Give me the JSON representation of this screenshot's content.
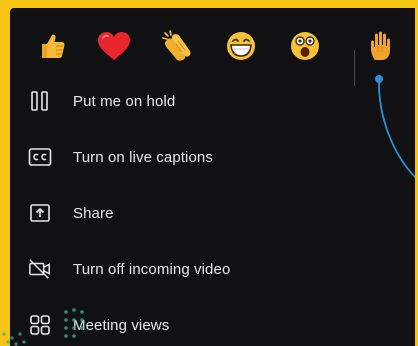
{
  "reactions": [
    {
      "icon": "thumbs-up-icon"
    },
    {
      "icon": "heart-icon"
    },
    {
      "icon": "clapping-hands-icon"
    },
    {
      "icon": "laughing-face-icon"
    },
    {
      "icon": "surprised-face-icon"
    },
    {
      "icon": "raised-hand-icon"
    }
  ],
  "menu": {
    "items": [
      {
        "label": "Put me on hold",
        "icon": "pause-icon"
      },
      {
        "label": "Turn on live captions",
        "icon": "closed-captions-icon"
      },
      {
        "label": "Share",
        "icon": "share-tray-icon"
      },
      {
        "label": "Turn off incoming video",
        "icon": "video-off-icon"
      },
      {
        "label": "Meeting views",
        "icon": "grid-view-icon"
      }
    ]
  },
  "colors": {
    "frame": "#f4c512",
    "panel": "#111114",
    "text": "#e8e8ec",
    "pointer": "#2f8fd8"
  }
}
